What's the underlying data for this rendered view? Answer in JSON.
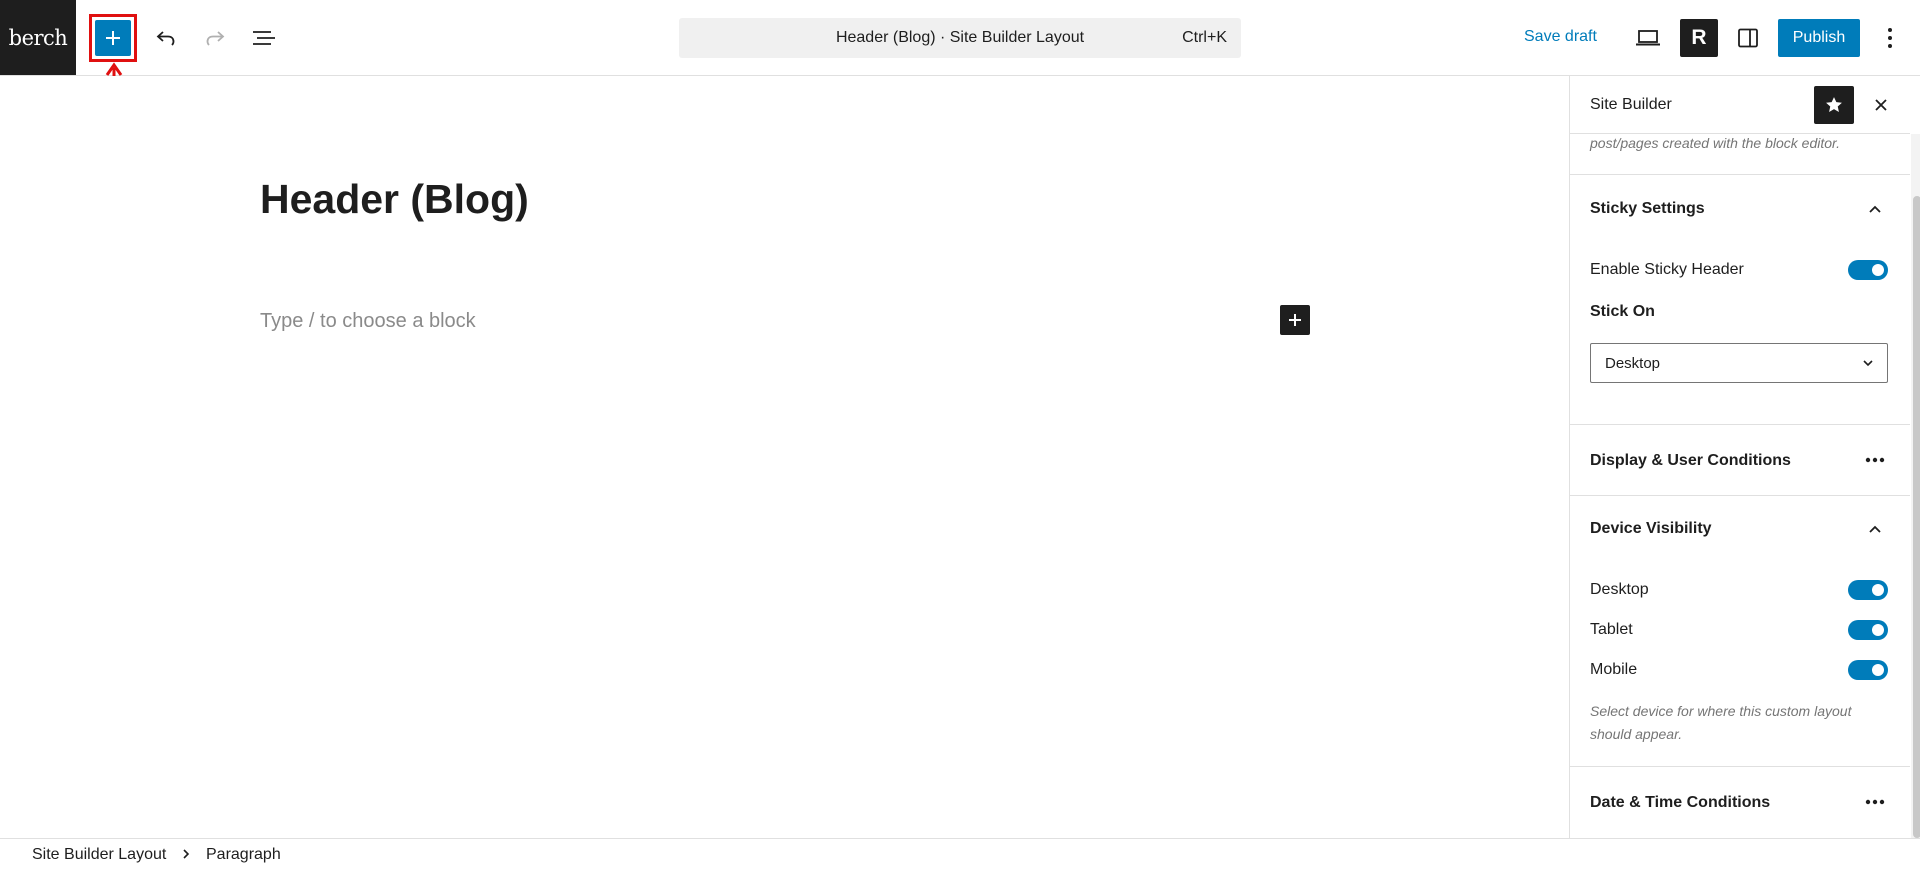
{
  "topbar": {
    "site_logo_text": "berch",
    "command_bar": {
      "label": "Header (Blog) · Site Builder Layout",
      "shortcut": "Ctrl+K"
    },
    "save_draft_label": "Save draft",
    "r_badge_label": "R",
    "publish_label": "Publish",
    "icons": {
      "inserter": "plus-icon",
      "undo": "undo-icon",
      "redo": "redo-icon",
      "list_view": "list-view-icon",
      "preview": "laptop-icon",
      "settings": "sidebar-toggle-icon",
      "options": "more-vertical-icon"
    }
  },
  "editor": {
    "post_title": "Header (Blog)",
    "block_placeholder": "Type / to choose a block"
  },
  "sidebar": {
    "title": "Site Builder",
    "cut_off_text": "post/pages created with the block editor.",
    "sticky_settings": {
      "title": "Sticky Settings",
      "enable_sticky_label": "Enable Sticky Header",
      "enable_sticky_on": true,
      "stick_on_label": "Stick On",
      "stick_on_value": "Desktop"
    },
    "display_conditions": {
      "title": "Display & User Conditions"
    },
    "device_visibility": {
      "title": "Device Visibility",
      "devices": [
        {
          "label": "Desktop",
          "on": true
        },
        {
          "label": "Tablet",
          "on": true
        },
        {
          "label": "Mobile",
          "on": true
        }
      ],
      "help_text": "Select device for where this custom layout should appear."
    },
    "date_time_conditions": {
      "title": "Date & Time Conditions"
    }
  },
  "breadcrumb": {
    "items": [
      "Site Builder Layout",
      "Paragraph"
    ]
  },
  "colors": {
    "accent": "#007cba",
    "dark": "#1e1e1e",
    "annotation": "#e01010",
    "muted": "#757575"
  }
}
